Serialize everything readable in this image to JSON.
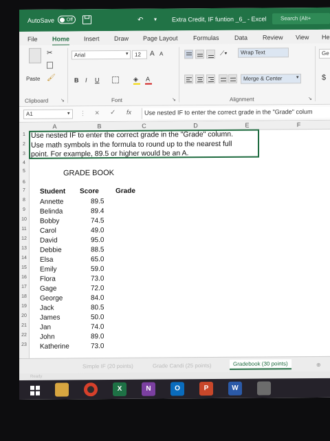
{
  "titlebar": {
    "autosave_label": "AutoSave",
    "autosave_state": "Off",
    "doc_title": "Extra Credit, IF funtion _6_ - Excel",
    "search_placeholder": "Search (Alt+"
  },
  "ribbon_tabs": [
    "File",
    "Home",
    "Insert",
    "Draw",
    "Page Layout",
    "Formulas",
    "Data",
    "Review",
    "View",
    "He"
  ],
  "active_tab": "Home",
  "ribbon": {
    "paste_label": "Paste",
    "clipboard_label": "Clipboard",
    "font_name": "Arial",
    "font_size": "12",
    "font_label": "Font",
    "bold": "B",
    "italic": "I",
    "underline": "U",
    "grow_font": "A",
    "shrink_font": "A",
    "wrap_text": "Wrap Text",
    "merge_center": "Merge & Center",
    "alignment_label": "Alignment",
    "currency": "$",
    "general_cut": "Ge"
  },
  "formula_bar": {
    "cell_ref": "A1",
    "fx": "fx",
    "cancel": "×",
    "enter": "✓",
    "formula": "Use nested IF to enter the correct grade in the \"Grade\" colum"
  },
  "columns": [
    "A",
    "B",
    "C",
    "D",
    "E",
    "F"
  ],
  "rows": [
    "1",
    "2",
    "3",
    "4",
    "5",
    "6",
    "7",
    "8",
    "9",
    "10",
    "11",
    "12",
    "13",
    "14",
    "15",
    "16",
    "17",
    "18",
    "19",
    "20",
    "21",
    "22",
    "23"
  ],
  "instructions": [
    "Use nested IF to enter the correct grade in the \"Grade\" column.",
    "Use math symbols in the formula to round up to the nearest full",
    "point. For example, 89.5 or higher would be an A."
  ],
  "sheet_title": "GRADE BOOK",
  "table_headers": [
    "Student",
    "Score",
    "Grade"
  ],
  "students": [
    {
      "name": "Annette",
      "score": "89.5"
    },
    {
      "name": "Belinda",
      "score": "89.4"
    },
    {
      "name": "Bobby",
      "score": "74.5"
    },
    {
      "name": "Carol",
      "score": "49.0"
    },
    {
      "name": "David",
      "score": "95.0"
    },
    {
      "name": "Debbie",
      "score": "88.5"
    },
    {
      "name": "Elsa",
      "score": "65.0"
    },
    {
      "name": "Emily",
      "score": "59.0"
    },
    {
      "name": "Flora",
      "score": "73.0"
    },
    {
      "name": "Gage",
      "score": "72.0"
    },
    {
      "name": "George",
      "score": "84.0"
    },
    {
      "name": "Jack",
      "score": "80.5"
    },
    {
      "name": "James",
      "score": "50.0"
    },
    {
      "name": "Jan",
      "score": "74.0"
    },
    {
      "name": "John",
      "score": "89.0"
    },
    {
      "name": "Katherine",
      "score": "73.0"
    }
  ],
  "sheet_tabs": [
    "Simple IF (20 points)",
    "Grade Candi (25 points)",
    "Gradebook (30 points)"
  ],
  "active_sheet": "Gradebook (30 points)",
  "status": "Ready",
  "colors": {
    "excel_green": "#217346",
    "active_green": "#1e6b3f",
    "taskbar": "#25222a"
  }
}
